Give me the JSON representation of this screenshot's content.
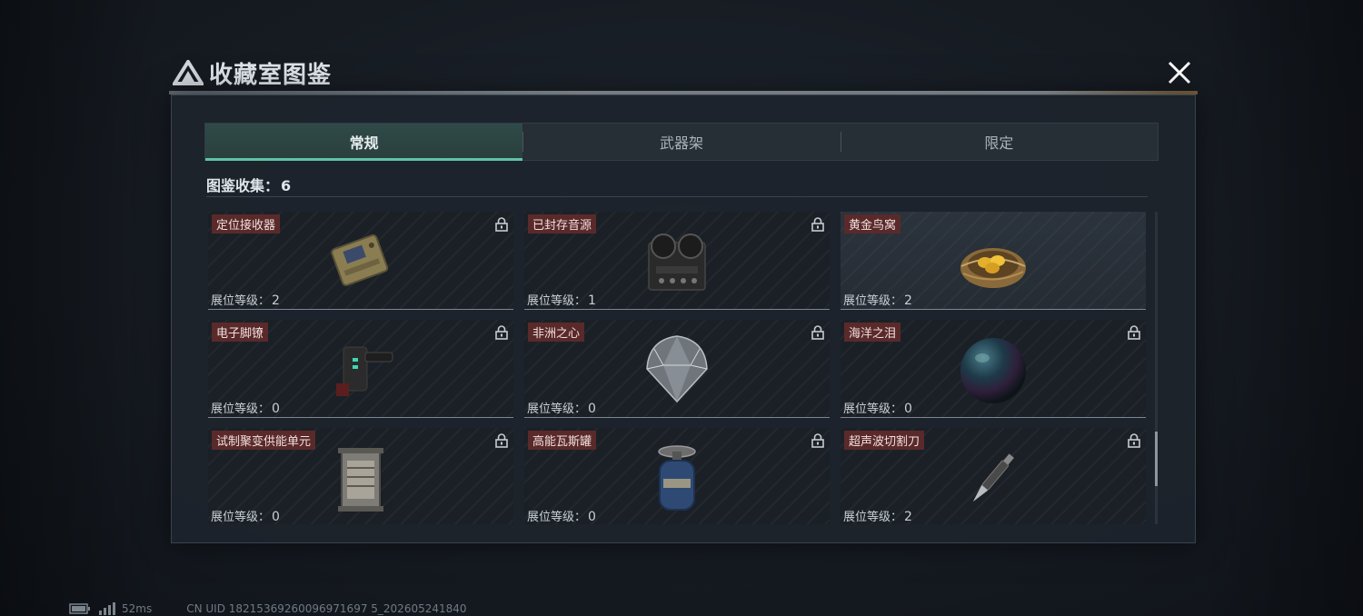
{
  "header": {
    "title": "收藏室图鉴",
    "logo_icon": "triangle-logo-icon",
    "close_icon": "close-icon"
  },
  "tabs": [
    {
      "label": "常规",
      "active": true
    },
    {
      "label": "武器架",
      "active": false
    },
    {
      "label": "限定",
      "active": false
    }
  ],
  "collection": {
    "label": "图鉴收集：",
    "count": "6"
  },
  "level_label": "展位等级：",
  "items": [
    {
      "name": "定位接收器",
      "level": "2",
      "locked": true,
      "icon": "gps-receiver-icon"
    },
    {
      "name": "已封存音源",
      "level": "1",
      "locked": true,
      "icon": "tape-recorder-icon"
    },
    {
      "name": "黄金鸟窝",
      "level": "2",
      "locked": false,
      "icon": "golden-nest-icon"
    },
    {
      "name": "电子脚镣",
      "level": "0",
      "locked": true,
      "icon": "ankle-monitor-icon"
    },
    {
      "name": "非洲之心",
      "level": "0",
      "locked": true,
      "icon": "diamond-icon"
    },
    {
      "name": "海洋之泪",
      "level": "0",
      "locked": true,
      "icon": "pearl-icon"
    },
    {
      "name": "试制聚变供能单元",
      "level": "0",
      "locked": true,
      "icon": "fusion-cell-icon"
    },
    {
      "name": "高能瓦斯罐",
      "level": "0",
      "locked": true,
      "icon": "gas-canister-icon"
    },
    {
      "name": "超声波切割刀",
      "level": "2",
      "locked": true,
      "icon": "ultrasonic-cutter-icon"
    }
  ],
  "status": {
    "battery_icon": "battery-icon",
    "signal_icon": "signal-icon",
    "ping": "52ms",
    "uid": "CN UID 18215369260096971697 5_202605241840"
  },
  "colors": {
    "accent": "#5fc3a6",
    "name_tag": "#5a2a2a",
    "panel": "#1d242c"
  }
}
